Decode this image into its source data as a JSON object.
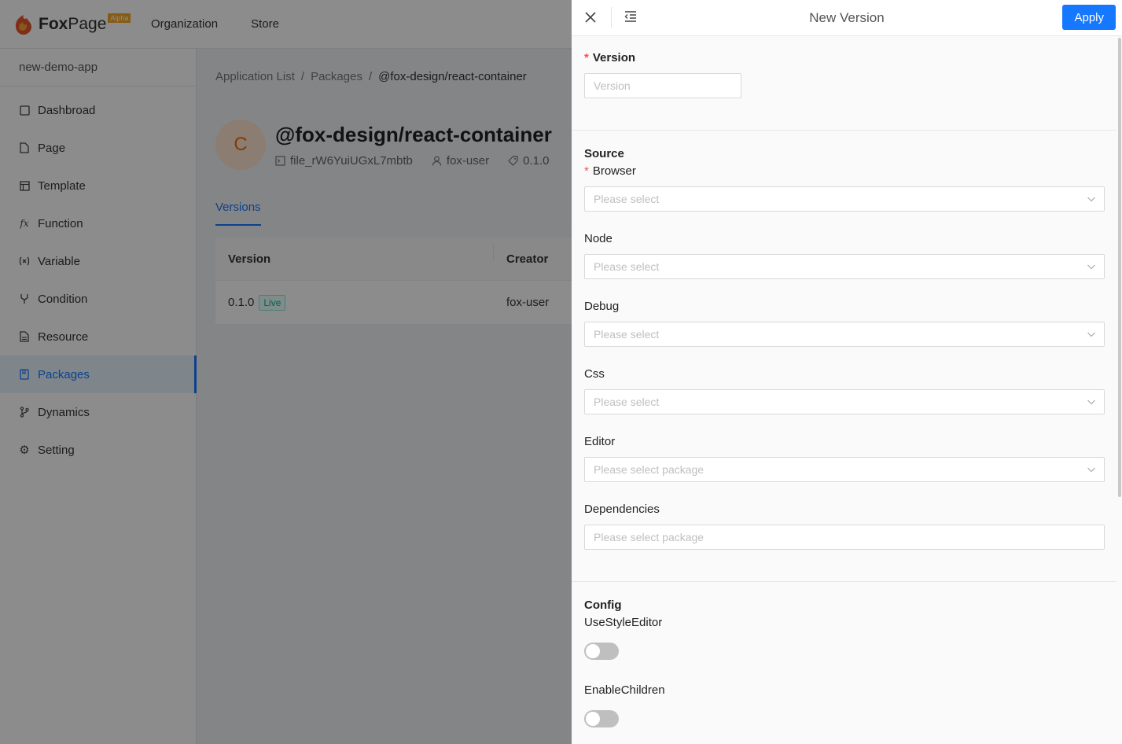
{
  "header": {
    "logo_text_bold": "Fox",
    "logo_text": "Page",
    "logo_badge": "Alpha",
    "nav": [
      "Organization",
      "Store"
    ]
  },
  "sidebar": {
    "app_name": "new-demo-app",
    "items": [
      {
        "label": "Dashbroad",
        "icon": "square-icon"
      },
      {
        "label": "Page",
        "icon": "file-icon"
      },
      {
        "label": "Template",
        "icon": "layout-icon"
      },
      {
        "label": "Function",
        "icon": "fx-icon"
      },
      {
        "label": "Variable",
        "icon": "variable-icon"
      },
      {
        "label": "Condition",
        "icon": "branch-icon"
      },
      {
        "label": "Resource",
        "icon": "document-icon"
      },
      {
        "label": "Packages",
        "icon": "book-icon",
        "active": true
      },
      {
        "label": "Dynamics",
        "icon": "git-icon"
      },
      {
        "label": "Setting",
        "icon": "gear-icon"
      }
    ]
  },
  "main": {
    "breadcrumb": [
      "Application List",
      "Packages",
      "@fox-design/react-container"
    ],
    "avatar_letter": "C",
    "package_name": "@fox-design/react-container",
    "meta": {
      "file_id": "file_rW6YuiUGxL7mbtb",
      "user": "fox-user",
      "version": "0.1.0"
    },
    "tab": "Versions",
    "table": {
      "columns": [
        "Version",
        "Creator"
      ],
      "rows": [
        {
          "version": "0.1.0",
          "tag": "Live",
          "creator": "fox-user"
        }
      ]
    }
  },
  "drawer": {
    "title": "New Version",
    "apply_label": "Apply",
    "version": {
      "label": "Version",
      "placeholder": "Version"
    },
    "source": {
      "heading": "Source",
      "browser": {
        "label": "Browser",
        "placeholder": "Please select"
      },
      "node": {
        "label": "Node",
        "placeholder": "Please select"
      },
      "debug": {
        "label": "Debug",
        "placeholder": "Please select"
      },
      "css": {
        "label": "Css",
        "placeholder": "Please select"
      },
      "editor": {
        "label": "Editor",
        "placeholder": "Please select package"
      },
      "dependencies": {
        "label": "Dependencies",
        "placeholder": "Please select package"
      }
    },
    "config": {
      "heading": "Config",
      "use_style_editor": {
        "label": "UseStyleEditor",
        "on": false
      },
      "enable_children": {
        "label": "EnableChildren",
        "on": false
      }
    }
  },
  "colors": {
    "primary": "#1677ff",
    "required": "#ff4d4f",
    "live_tag": "#13a89e",
    "avatar_bg": "#fde3cf",
    "avatar_fg": "#f56a00"
  }
}
